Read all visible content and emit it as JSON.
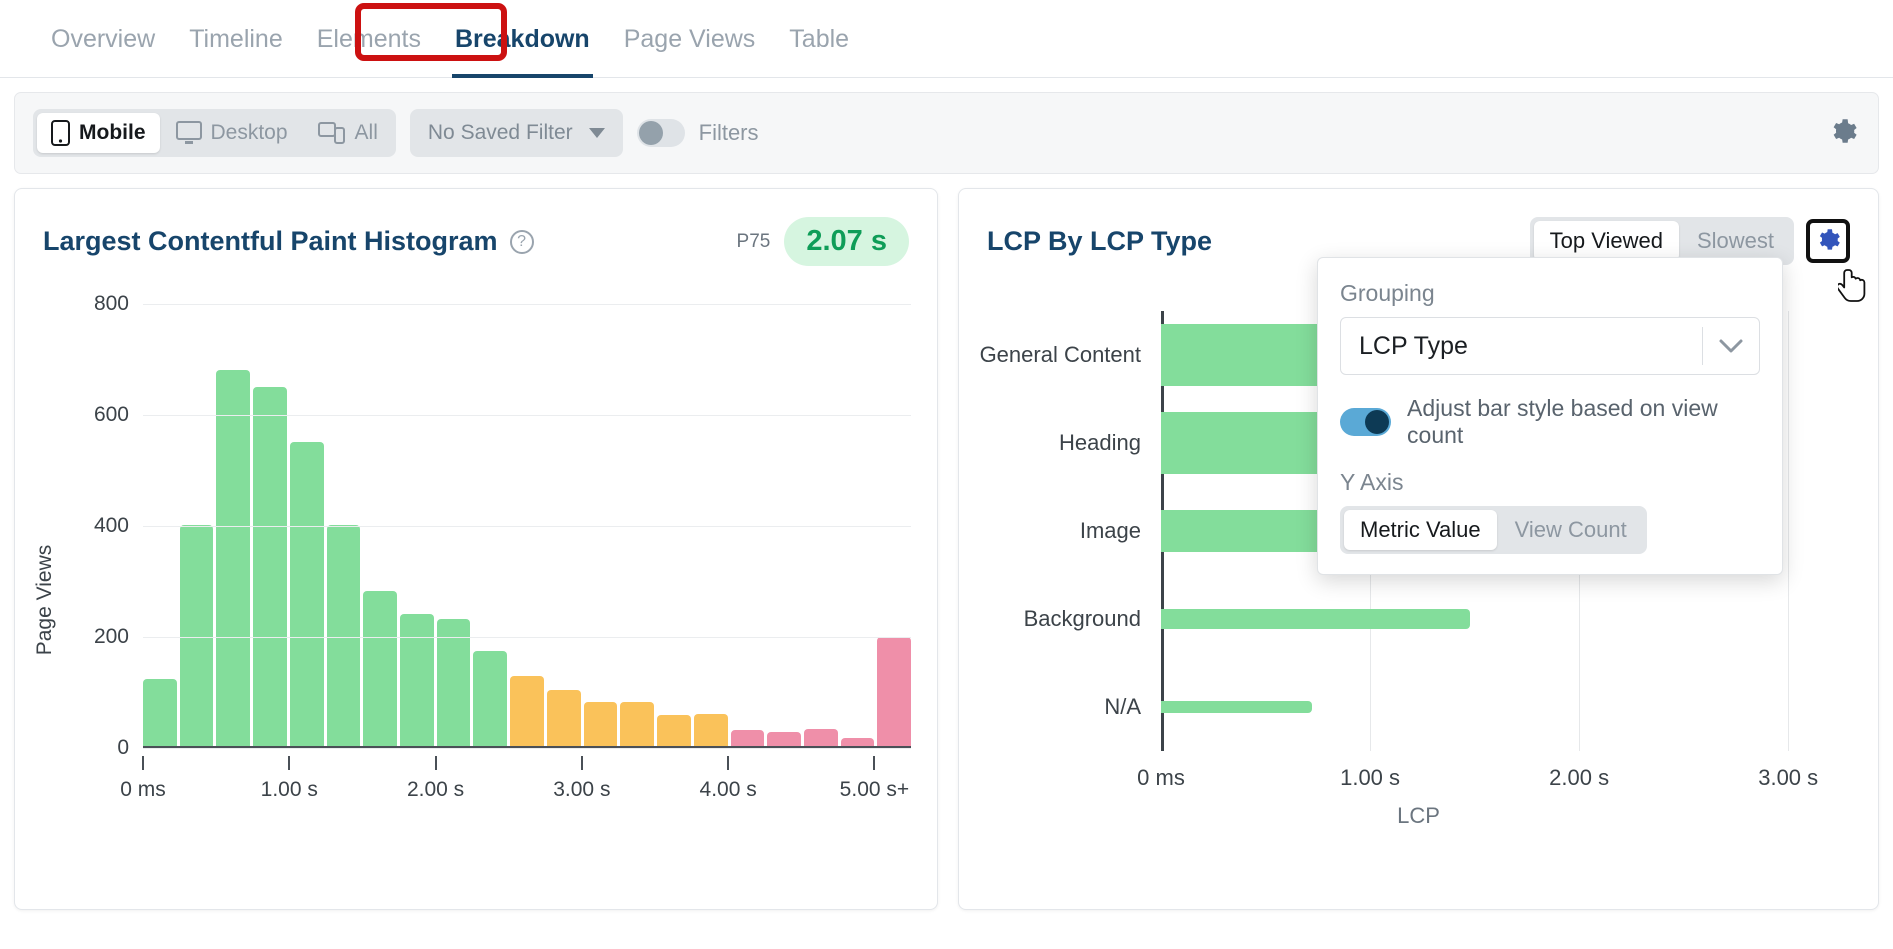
{
  "tabs": [
    {
      "label": "Overview",
      "active": false
    },
    {
      "label": "Timeline",
      "active": false
    },
    {
      "label": "Elements",
      "active": false
    },
    {
      "label": "Breakdown",
      "active": true
    },
    {
      "label": "Page Views",
      "active": false
    },
    {
      "label": "Table",
      "active": false
    }
  ],
  "toolbar": {
    "device_options": [
      {
        "label": "Mobile",
        "icon": "mobile-icon",
        "active": true
      },
      {
        "label": "Desktop",
        "icon": "desktop-icon",
        "active": false
      },
      {
        "label": "All",
        "icon": "all-devices-icon",
        "active": false
      }
    ],
    "saved_filter": "No Saved Filter",
    "filters_label": "Filters",
    "filters_enabled": false,
    "settings_icon": "gear-icon"
  },
  "left_panel": {
    "title": "Largest Contentful Paint Histogram",
    "help_icon": "help-icon",
    "p75_label": "P75",
    "p75_value": "2.07 s"
  },
  "right_panel": {
    "title": "LCP By LCP Type",
    "view_toggle": [
      {
        "label": "Top Viewed",
        "active": true
      },
      {
        "label": "Slowest",
        "active": false
      }
    ],
    "settings_icon": "gear-icon"
  },
  "popover": {
    "grouping_label": "Grouping",
    "grouping_value": "LCP Type",
    "dropdown_icon": "chevron-down-icon",
    "adjust_toggle_label": "Adjust bar style based on view count",
    "adjust_toggle_on": true,
    "yaxis_label": "Y Axis",
    "yaxis_options": [
      {
        "label": "Metric Value",
        "active": true
      },
      {
        "label": "View Count",
        "active": false
      }
    ]
  },
  "colors": {
    "good": "#83dd9b",
    "needs_improvement": "#fac25a",
    "poor": "#ef8fa9",
    "title": "#17456b",
    "accent_blue": "#3355bb",
    "highlight_red": "#cc1111"
  },
  "chart_data": [
    {
      "type": "bar",
      "title": "Largest Contentful Paint Histogram",
      "xlabel": "",
      "ylabel": "Page Views",
      "ylim": [
        0,
        800
      ],
      "yticks": [
        0,
        200,
        400,
        600,
        800
      ],
      "xticks": [
        "0 ms",
        "1.00 s",
        "2.00 s",
        "3.00 s",
        "4.00 s",
        "5.00 s+"
      ],
      "grid": true,
      "legend": "none",
      "categories": [
        "0.00",
        "0.25",
        "0.50",
        "0.75",
        "1.00",
        "1.25",
        "1.50",
        "1.75",
        "2.00",
        "2.25",
        "2.50",
        "2.75",
        "3.00",
        "3.25",
        "3.50",
        "3.75",
        "4.00",
        "4.25",
        "4.50",
        "4.75",
        "5.00+"
      ],
      "values": [
        120,
        398,
        677,
        646,
        548,
        398,
        280,
        238,
        228,
        171,
        127,
        101,
        79,
        80,
        55,
        57,
        28,
        25,
        30,
        15,
        196
      ],
      "bar_colors": [
        "#83dd9b",
        "#83dd9b",
        "#83dd9b",
        "#83dd9b",
        "#83dd9b",
        "#83dd9b",
        "#83dd9b",
        "#83dd9b",
        "#83dd9b",
        "#83dd9b",
        "#fac25a",
        "#fac25a",
        "#fac25a",
        "#fac25a",
        "#fac25a",
        "#fac25a",
        "#ef8fa9",
        "#ef8fa9",
        "#ef8fa9",
        "#ef8fa9",
        "#ef8fa9"
      ]
    },
    {
      "type": "bar",
      "orientation": "horizontal",
      "title": "LCP By LCP Type",
      "xlabel": "LCP",
      "ylabel": "",
      "xlim": [
        0,
        3.2
      ],
      "xticks": [
        "0 ms",
        "1.00 s",
        "2.00 s",
        "3.00 s"
      ],
      "xtick_values": [
        0,
        1,
        2,
        3
      ],
      "categories": [
        "General Content",
        "Heading",
        "Image",
        "Background",
        "N/A"
      ],
      "values": [
        1.22,
        1.22,
        2.38,
        1.48,
        0.72
      ],
      "view_weights": [
        62,
        62,
        42,
        20,
        12
      ],
      "bar_color": "#83dd9b",
      "grid": true
    }
  ]
}
